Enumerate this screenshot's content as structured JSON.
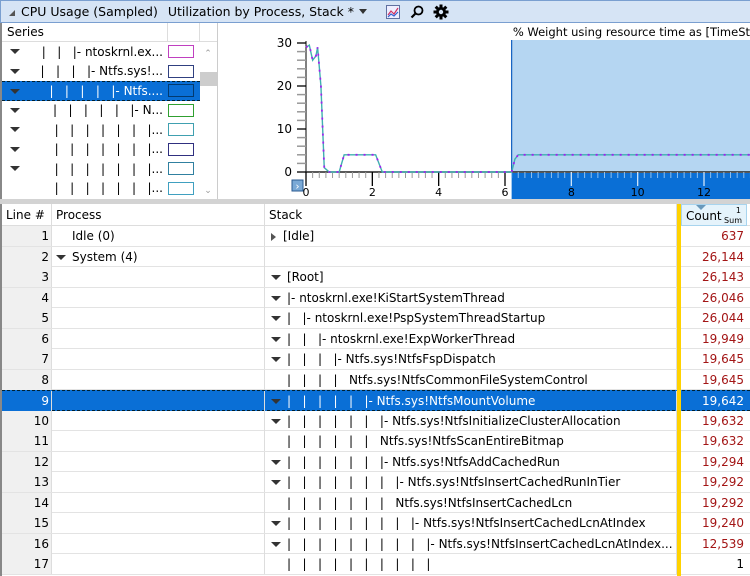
{
  "titlebar": {
    "title": "CPU Usage (Sampled)",
    "preset": "Utilization by Process, Stack *",
    "icons": [
      "graph-view-icon",
      "search-icon",
      "gear-icon"
    ]
  },
  "series": {
    "header": "Series",
    "rows": [
      {
        "label": "|   |   |- ntoskrnl.ex...",
        "color": "#c040c0",
        "expanded": true,
        "selected": false
      },
      {
        "label": "|   |   |   |- Ntfs.sys!...",
        "color": "#304080",
        "expanded": true,
        "selected": false
      },
      {
        "label": "|   |   |   |   |- Ntfs....",
        "color": "#0050a0",
        "expanded": true,
        "selected": true
      },
      {
        "label": "|   |   |   |   |   |- N...",
        "color": "#30a030",
        "expanded": true,
        "selected": false
      },
      {
        "label": "|   |   |   |   |   |   |...",
        "color": "#40a0b0",
        "expanded": true,
        "selected": false
      },
      {
        "label": "|   |   |   |   |   |   |...",
        "color": "#303080",
        "expanded": true,
        "selected": false
      },
      {
        "label": "|   |   |   |   |   |   |...",
        "color": "#3080a0",
        "expanded": true,
        "selected": false
      },
      {
        "label": "|   |   |   |   |   |   |...",
        "color": "#40a0c0",
        "expanded": false,
        "selected": false
      }
    ]
  },
  "chart_data": {
    "type": "line",
    "title": "% Weight using resource time as [TimeSt",
    "xlabel": "",
    "ylabel": "",
    "xlim": [
      0,
      14
    ],
    "ylim": [
      0,
      30
    ],
    "xticks": [
      0,
      2,
      4,
      6,
      8,
      10,
      12
    ],
    "yticks": [
      0,
      10,
      20,
      30
    ],
    "selection_range": [
      6.2,
      14
    ],
    "grid": false,
    "legend": "none",
    "series": [
      {
        "name": "teal",
        "color": "#40b0b0",
        "x": [
          0,
          0.1,
          0.2,
          0.3,
          0.35,
          0.45,
          0.55,
          0.7,
          0.9,
          1.0,
          1.15,
          1.3,
          1.5,
          1.8,
          2.0,
          2.1,
          2.3,
          2.5,
          3,
          4,
          5,
          6,
          6.2,
          6.3,
          6.4,
          7,
          8,
          9,
          10,
          11,
          12,
          13,
          14
        ],
        "y": [
          29,
          29.5,
          26,
          27,
          29,
          20,
          1,
          0,
          0,
          0,
          4,
          4,
          4,
          4,
          4,
          4,
          0,
          0,
          0,
          0,
          0,
          0,
          0,
          3,
          4,
          4,
          4,
          4,
          4,
          4,
          4,
          4,
          4
        ]
      },
      {
        "name": "purple",
        "color": "#a020f0",
        "x": [
          0,
          0.1,
          0.2,
          0.3,
          0.35,
          0.45,
          0.55,
          0.7,
          0.9,
          1.0,
          1.15,
          1.3,
          1.5,
          1.8,
          2.0,
          2.1,
          2.3,
          2.5,
          3,
          4,
          5,
          6,
          6.2,
          6.3,
          6.4,
          7,
          8,
          9,
          10,
          11,
          12,
          13,
          14
        ],
        "y": [
          29,
          29.5,
          26,
          27,
          29,
          20,
          1,
          0,
          0,
          0,
          4,
          4,
          4,
          4,
          4,
          4,
          0,
          0,
          0,
          0,
          0,
          0,
          0,
          3,
          4,
          4,
          4,
          4,
          4,
          4,
          4,
          4,
          4
        ]
      }
    ]
  },
  "table": {
    "columns": {
      "line": "Line #",
      "process": "Process",
      "stack": "Stack",
      "count": "Count",
      "count_sub": "Sum",
      "count_sort_index": "1"
    },
    "rows": [
      {
        "line": "1",
        "process": "Idle (0)",
        "process_exp": "none",
        "stack": "[Idle]",
        "stack_exp": "right",
        "stack_prefix": "",
        "count": "637"
      },
      {
        "line": "2",
        "process": "System (4)",
        "process_exp": "down",
        "stack": "",
        "stack_exp": "",
        "stack_prefix": "",
        "count": "26,144"
      },
      {
        "line": "3",
        "process": "",
        "process_exp": "",
        "stack": "[Root]",
        "stack_exp": "down",
        "stack_prefix": "",
        "count": "26,143"
      },
      {
        "line": "4",
        "process": "",
        "process_exp": "",
        "stack": "|- ntoskrnl.exe!KiStartSystemThread",
        "stack_exp": "down",
        "stack_prefix": "",
        "count": "26,046"
      },
      {
        "line": "5",
        "process": "",
        "process_exp": "",
        "stack": "|- ntoskrnl.exe!PspSystemThreadStartup",
        "stack_exp": "down",
        "stack_prefix": "|   ",
        "count": "26,044"
      },
      {
        "line": "6",
        "process": "",
        "process_exp": "",
        "stack": "|- ntoskrnl.exe!ExpWorkerThread",
        "stack_exp": "down",
        "stack_prefix": "|   |   ",
        "count": "19,949"
      },
      {
        "line": "7",
        "process": "",
        "process_exp": "",
        "stack": "|- Ntfs.sys!NtfsFspDispatch",
        "stack_exp": "down",
        "stack_prefix": "|   |   |   ",
        "count": "19,645"
      },
      {
        "line": "8",
        "process": "",
        "process_exp": "",
        "stack": "Ntfs.sys!NtfsCommonFileSystemControl",
        "stack_exp": "none",
        "stack_prefix": "|   |   |   |   ",
        "count": "19,645"
      },
      {
        "line": "9",
        "process": "",
        "process_exp": "",
        "stack": "|- Ntfs.sys!NtfsMountVolume",
        "stack_exp": "down",
        "stack_prefix": "|   |   |   |   |   ",
        "count": "19,642",
        "selected": true
      },
      {
        "line": "10",
        "process": "",
        "process_exp": "",
        "stack": "|- Ntfs.sys!NtfsInitializeClusterAllocation",
        "stack_exp": "down",
        "stack_prefix": "|   |   |   |   |   |   ",
        "count": "19,632"
      },
      {
        "line": "11",
        "process": "",
        "process_exp": "",
        "stack": "Ntfs.sys!NtfsScanEntireBitmap",
        "stack_exp": "none",
        "stack_prefix": "|   |   |   |   |   |   ",
        "count": "19,632"
      },
      {
        "line": "12",
        "process": "",
        "process_exp": "",
        "stack": "|- Ntfs.sys!NtfsAddCachedRun",
        "stack_exp": "down",
        "stack_prefix": "|   |   |   |   |   |   ",
        "count": "19,294"
      },
      {
        "line": "13",
        "process": "",
        "process_exp": "",
        "stack": "|- Ntfs.sys!NtfsInsertCachedRunInTier",
        "stack_exp": "down",
        "stack_prefix": "|   |   |   |   |   |   |   ",
        "count": "19,292"
      },
      {
        "line": "14",
        "process": "",
        "process_exp": "",
        "stack": "Ntfs.sys!NtfsInsertCachedLcn",
        "stack_exp": "none",
        "stack_prefix": "|   |   |   |   |   |   |   ",
        "count": "19,292"
      },
      {
        "line": "15",
        "process": "",
        "process_exp": "",
        "stack": "|- Ntfs.sys!NtfsInsertCachedLcnAtIndex",
        "stack_exp": "down",
        "stack_prefix": "|   |   |   |   |   |   |   |   ",
        "count": "19,240"
      },
      {
        "line": "16",
        "process": "",
        "process_exp": "",
        "stack": "|- Ntfs.sys!NtfsInsertCachedLcnAtIndex...",
        "stack_exp": "down",
        "stack_prefix": "|   |   |   |   |   |   |   |   |   ",
        "count": "12,539"
      },
      {
        "line": "17",
        "process": "",
        "process_exp": "",
        "stack": "",
        "stack_exp": "none",
        "stack_prefix": "|   |   |   |   |   |   |   |   |   |",
        "count": "1",
        "count_black": true
      }
    ]
  }
}
